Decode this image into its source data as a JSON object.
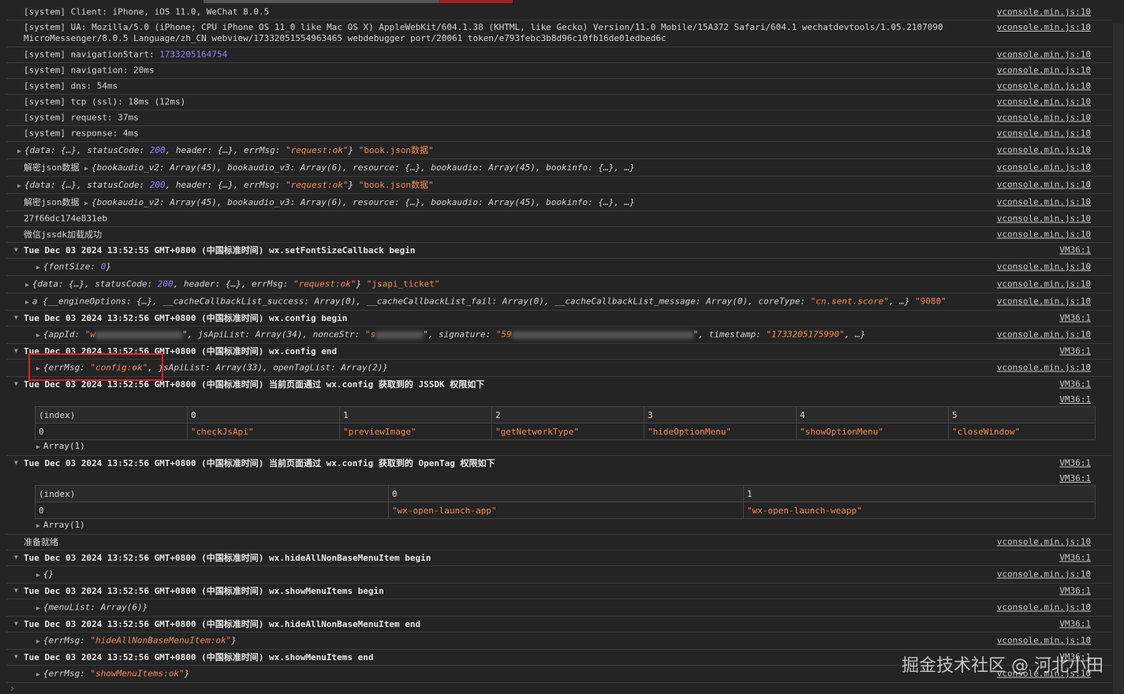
{
  "console": {
    "rows": [
      {
        "text": "[system] Client: iPhone, iOS 11.0, WeChat 8.0.5",
        "src": "vconsole.min.js:10"
      },
      {
        "text": "[system] UA: Mozilla/5.0 (iPhone; CPU iPhone OS 11_0 like Mac OS X) AppleWebKit/604.1.38 (KHTML, like Gecko) Version/11.0 Mobile/15A372 Safari/604.1 wechatdevtools/1.05.2107090",
        "text2": "MicroMessenger/8.0.5 Language/zh_CN webview/17332051554963465 webdebugger port/20061 token/e793febc3b8d96c10fb16de01edbed6c",
        "src": "vconsole.min.js:10"
      },
      {
        "text": "[system] navigationStart: ",
        "num": "1733205164754",
        "src": "vconsole.min.js:10"
      },
      {
        "text": "[system] navigation: 20ms",
        "src": "vconsole.min.js:10"
      },
      {
        "text": "[system] dns: 54ms",
        "src": "vconsole.min.js:10"
      },
      {
        "text": "[system] tcp (ssl): 18ms (12ms)",
        "src": "vconsole.min.js:10"
      },
      {
        "text": "[system] request: 37ms",
        "src": "vconsole.min.js:10"
      },
      {
        "text": "[system] response: 4ms",
        "src": "vconsole.min.js:10"
      }
    ],
    "obj1": {
      "a": "{data: {…}, statusCode: ",
      "num": "200",
      "b": ", header: {…}, errMsg: ",
      "str": "\"request:ok\"",
      "c": "} ",
      "str2": "\"book.json数据\"",
      "src": "vconsole.min.js:10"
    },
    "dec1": {
      "label": "解密json数据 ",
      "obj": "{bookaudio_v2: Array(45), bookaudio_v3: Array(6), resource: {…}, bookaudio: Array(45), bookinfo: {…}, …}",
      "src": "vconsole.min.js:10"
    },
    "obj2": {
      "a": "{data: {…}, statusCode: ",
      "num": "200",
      "b": ", header: {…}, errMsg: ",
      "str": "\"request:ok\"",
      "c": "} ",
      "str2": "\"book.json数据\"",
      "src": "vconsole.min.js:10"
    },
    "dec2": {
      "label": "解密json数据 ",
      "obj": "{bookaudio_v2: Array(45), bookaudio_v3: Array(6), resource: {…}, bookaudio: Array(45), bookinfo: {…}, …}",
      "src": "vconsole.min.js:10"
    },
    "hash": {
      "text": "27f66dc174e831eb",
      "src": "vconsole.min.js:10"
    },
    "sdk": {
      "text": "微信jssdk加载成功",
      "src": "vconsole.min.js:10"
    },
    "grp1": {
      "text": "Tue Dec 03 2024 13:52:55 GMT+0800 (中国标准时间) wx.setFontSizeCallback begin",
      "src": "VM36:1"
    },
    "font": {
      "a": "{fontSize: ",
      "num": "0",
      "b": "}",
      "src": "vconsole.min.js:10"
    },
    "obj3": {
      "a": "{data: {…}, statusCode: ",
      "num": "200",
      "b": ", header: {…}, errMsg: ",
      "str": "\"request:ok\"",
      "c": "} ",
      "str2": "\"jsapi_ticket\"",
      "src": "vconsole.min.js:10"
    },
    "eng": {
      "a": "a {__engineOptions: {…}, __cacheCallbackList_success: Array(0), __cacheCallbackList_fail: Array(0), __cacheCallbackList_message: Array(0), coreType: ",
      "str": "\"cn.sent.score\"",
      "b": ", …} ",
      "str2": "\"9080\"",
      "src": "vconsole.min.js:10"
    },
    "grp2": {
      "text": "Tue Dec 03 2024 13:52:56 GMT+0800 (中国标准时间) wx.config begin",
      "src": "VM36:1"
    },
    "cfg": {
      "a": "{appId: ",
      "s1": "\"w",
      "b": "\", jsApiList: Array(34), nonceStr: ",
      "s2": "\"s",
      "c": "\", signature: ",
      "s3": "\"59",
      "d": "\", timestamp: ",
      "s4": "\"1733205175990\"",
      "e": ", …}",
      "src": "vconsole.min.js:10"
    },
    "grp3": {
      "text": "Tue Dec 03 2024 13:52:56 GMT+0800 (中国标准时间) wx.config end",
      "src": "VM36:1"
    },
    "cfgok": {
      "a": "{errMsg: ",
      "str": "\"config:ok\"",
      "b": ", jsApiList: Array(33), openTagList: Array(2)}",
      "src": "vconsole.min.js:10"
    },
    "grp4": {
      "text": "Tue Dec 03 2024 13:52:56 GMT+0800 (中国标准时间) 当前页面通过 wx.config 获取到的 JSSDK 权限如下",
      "src": "VM36:1",
      "src2": "VM36:1"
    },
    "table1": {
      "headers": [
        "(index)",
        "0",
        "1",
        "2",
        "3",
        "4",
        "5"
      ],
      "row": [
        "0",
        "\"checkJsApi\"",
        "\"previewImage\"",
        "\"getNetworkType\"",
        "\"hideOptionMenu\"",
        "\"showOptionMenu\"",
        "\"closeWindow\""
      ],
      "footer": "Array(1)"
    },
    "grp5": {
      "text": "Tue Dec 03 2024 13:52:56 GMT+0800 (中国标准时间) 当前页面通过 wx.config 获取到的 OpenTag 权限如下",
      "src": "VM36:1",
      "src2": "VM36:1"
    },
    "table2": {
      "headers": [
        "(index)",
        "0",
        "1"
      ],
      "row": [
        "0",
        "\"wx-open-launch-app\"",
        "\"wx-open-launch-weapp\""
      ],
      "footer": "Array(1)"
    },
    "ready": {
      "text": "准备就绪",
      "src": "vconsole.min.js:10"
    },
    "grp6": {
      "text": "Tue Dec 03 2024 13:52:56 GMT+0800 (中国标准时间) wx.hideAllNonBaseMenuItem begin",
      "src": "VM36:1"
    },
    "empty": {
      "text": "{}",
      "src": "vconsole.min.js:10"
    },
    "grp7": {
      "text": "Tue Dec 03 2024 13:52:56 GMT+0800 (中国标准时间) wx.showMenuItems begin",
      "src": "VM36:1"
    },
    "menu": {
      "text": "{menuList: Array(6)}",
      "src": "vconsole.min.js:10"
    },
    "grp8": {
      "text": "Tue Dec 03 2024 13:52:56 GMT+0800 (中国标准时间) wx.hideAllNonBaseMenuItem end",
      "src": "VM36:1"
    },
    "hideok": {
      "a": "{errMsg: ",
      "str": "\"hideAllNonBaseMenuItem:ok\"",
      "b": "}",
      "src": "vconsole.min.js:10"
    },
    "grp9": {
      "text": "Tue Dec 03 2024 13:52:56 GMT+0800 (中国标准时间) wx.showMenuItems end",
      "src": "VM36:1"
    },
    "showok": {
      "a": "{errMsg: ",
      "str": "\"showMenuItems:ok\"",
      "b": "}",
      "src": "vconsole.min.js:10"
    }
  },
  "watermark": "掘金技术社区 @ 河北小田",
  "prompt": "›",
  "icons": {
    "expand": "triangle-right-icon",
    "collapse": "triangle-down-icon"
  }
}
